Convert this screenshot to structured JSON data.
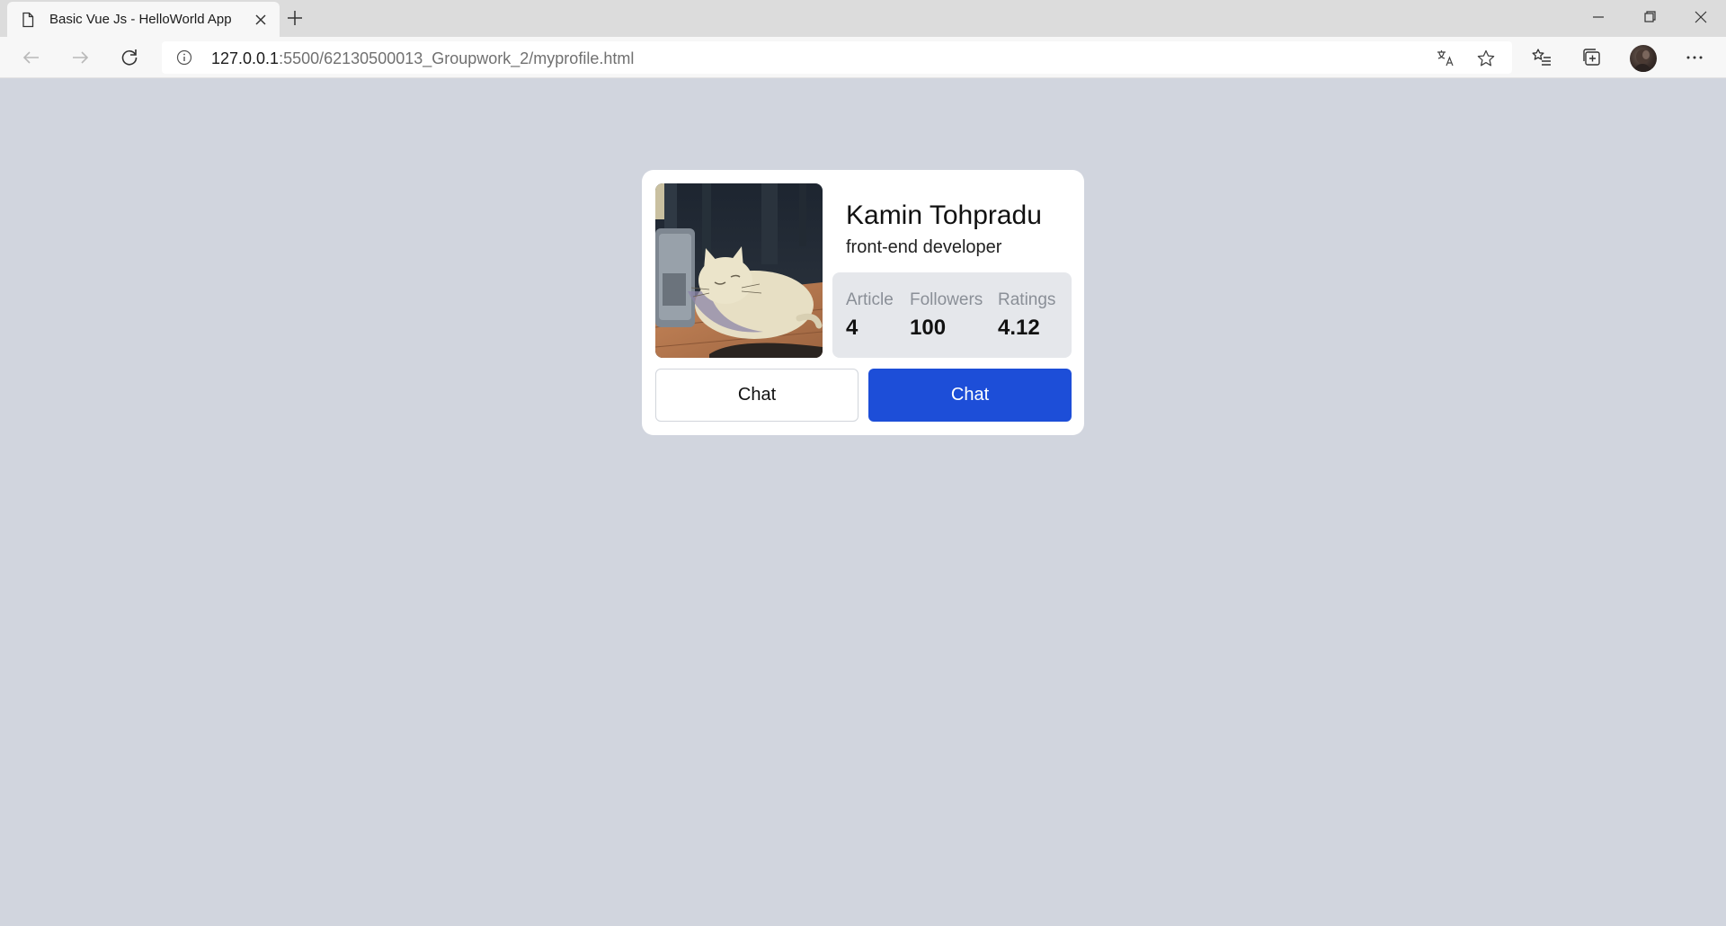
{
  "browser": {
    "tab": {
      "title": "Basic Vue Js - HelloWorld App"
    },
    "address_bar": {
      "host": "127.0.0.1",
      "path": ":5500/62130500013_Groupwork_2/myprofile.html"
    }
  },
  "icons": {
    "tab": [
      "page-icon",
      "close-icon",
      "plus-icon"
    ],
    "window": [
      "minimize-icon",
      "restore-icon",
      "close-icon"
    ],
    "nav": [
      "back-arrow-icon",
      "forward-arrow-icon",
      "reload-icon"
    ],
    "address": [
      "info-icon",
      "translate-icon",
      "star-icon"
    ],
    "toolbar": [
      "favorites-icon",
      "collections-icon",
      "profile-avatar",
      "more-icon"
    ]
  },
  "profile": {
    "name": "Kamin Tohpradu",
    "role": "front-end developer",
    "stats": [
      {
        "label": "Article",
        "value": "4"
      },
      {
        "label": "Followers",
        "value": "100"
      },
      {
        "label": "Ratings",
        "value": "4.12"
      }
    ],
    "buttons": {
      "secondary_label": "Chat",
      "primary_label": "Chat"
    }
  },
  "colors": {
    "page_background": "#d1d5de",
    "card_background": "#ffffff",
    "stats_background": "#e5e7eb",
    "primary_button": "#1d4ed8",
    "stat_label": "#8a8f97"
  }
}
